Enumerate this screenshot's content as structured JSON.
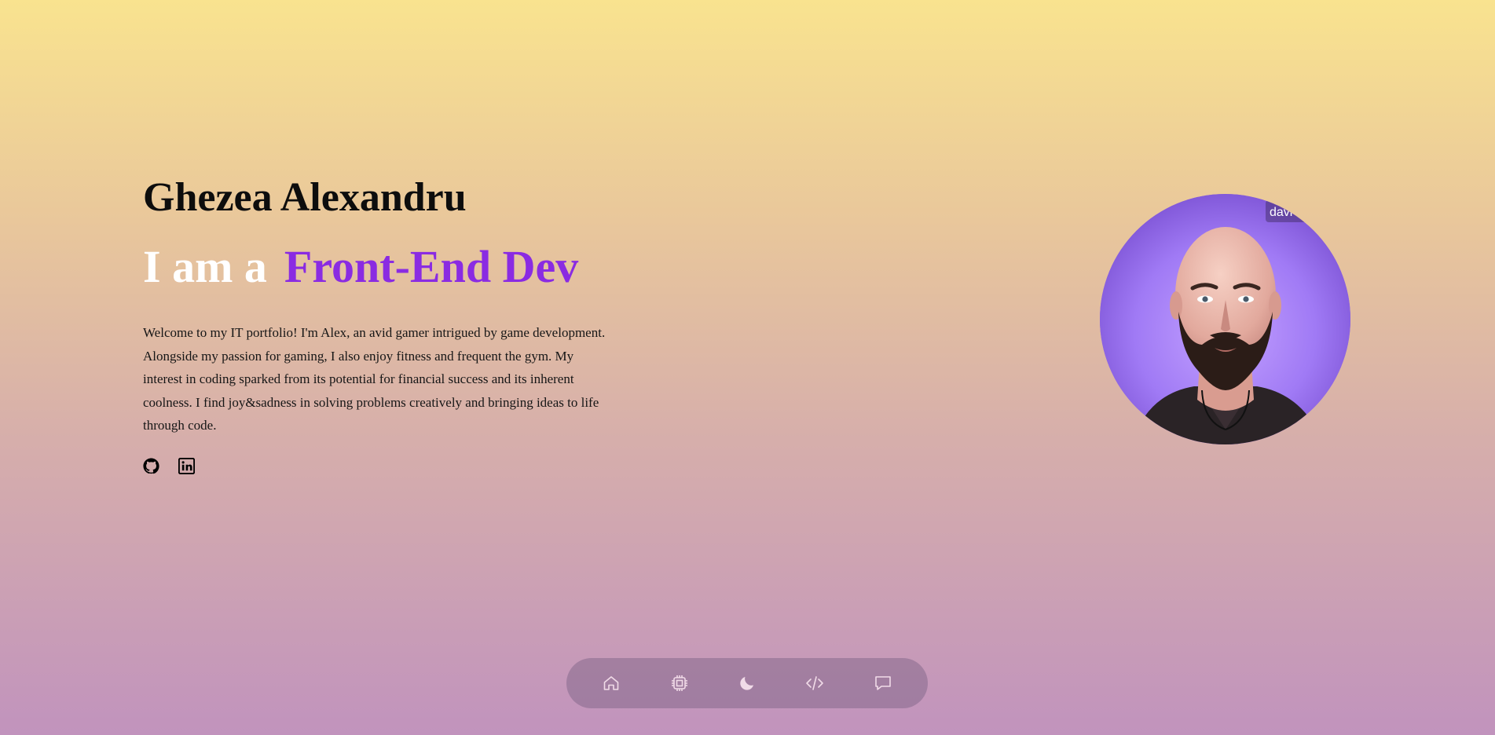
{
  "hero": {
    "name": "Ghezea Alexandru",
    "role_prefix": "I am a",
    "role_title": "Front-End Dev",
    "bio": "Welcome to my IT portfolio! I'm Alex, an avid gamer intrigued by game development. Alongside my passion for gaming, I also enjoy fitness and frequent the gym. My interest in coding sparked from its potential for financial success and its inherent coolness. I find joy&sadness in solving problems creatively and bringing ideas to life through code."
  },
  "socials": [
    {
      "icon": "github-icon"
    },
    {
      "icon": "linkedin-icon"
    }
  ],
  "avatar": {
    "watermark": "davi"
  },
  "dock": {
    "items": [
      {
        "icon": "home-icon"
      },
      {
        "icon": "chip-icon"
      },
      {
        "icon": "moon-icon"
      },
      {
        "icon": "code-icon"
      },
      {
        "icon": "chat-icon"
      }
    ]
  },
  "colors": {
    "accent": "#8a2be2",
    "text": "#0d0d0d",
    "role_prefix": "#ffffff",
    "gradient_top": "#f9e38f",
    "gradient_bottom": "#c193bd"
  }
}
